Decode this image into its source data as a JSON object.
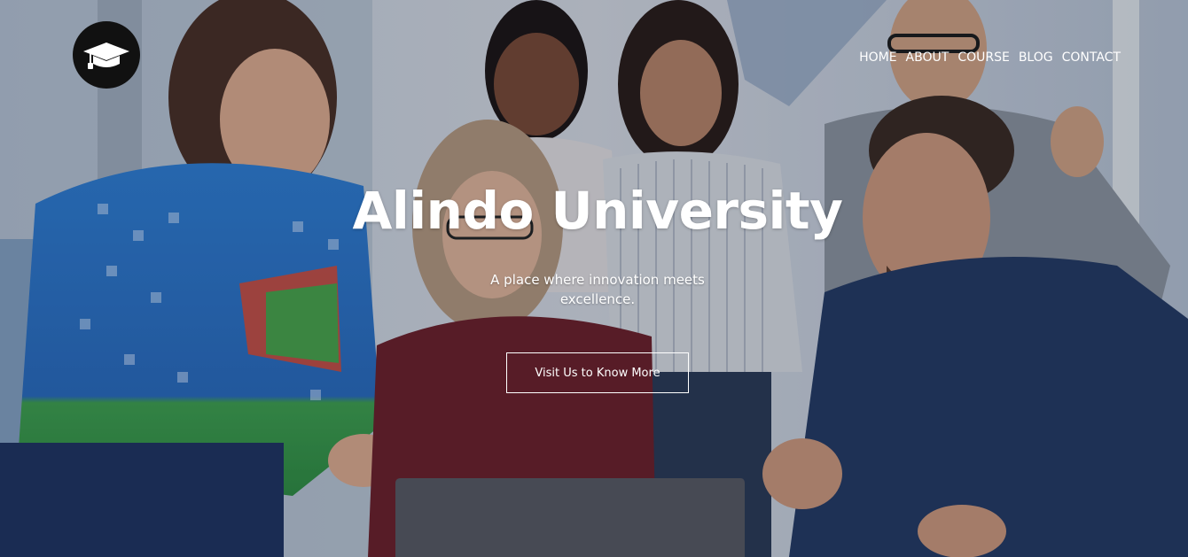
{
  "brand": {
    "logo_icon": "graduation-cap-icon",
    "logo_bg": "#111111"
  },
  "nav": {
    "items": [
      "HOME",
      "ABOUT",
      "COURSE",
      "BLOG",
      "CONTACT"
    ]
  },
  "hero": {
    "title": "Alindo University",
    "subtitle": "A place where innovation meets excellence.",
    "cta_label": "Visit Us to Know More",
    "background_description_icon": "group-photo-background"
  },
  "colors": {
    "text": "#ffffff",
    "overlay": "#0a1020"
  }
}
